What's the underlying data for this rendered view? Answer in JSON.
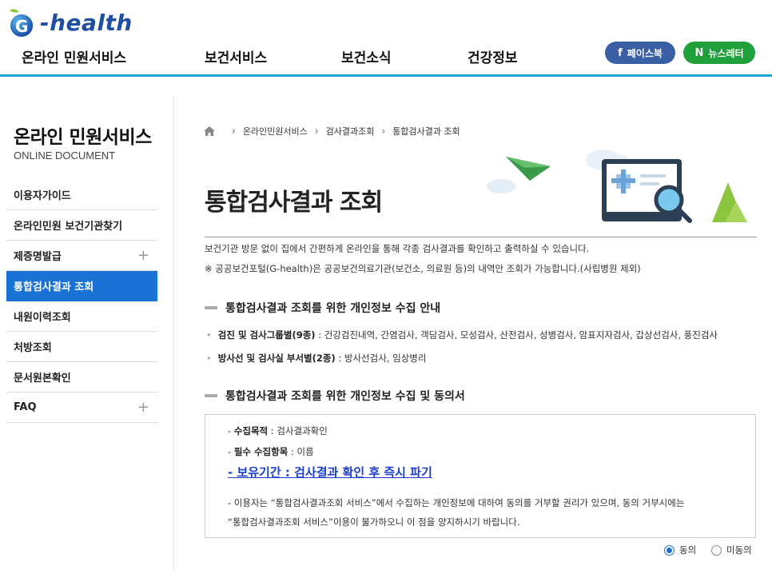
{
  "brand": {
    "logo_text": "-health"
  },
  "gnb": [
    "온라인 민원서비스",
    "보건서비스",
    "보건소식",
    "건강정보"
  ],
  "sns": {
    "facebook_label": "페이스북",
    "facebook_icon": "f",
    "newsletter_label": "뉴스레터",
    "newsletter_icon": "N"
  },
  "sidebar": {
    "title": "온라인 민원서비스",
    "subtitle": "ONLINE DOCUMENT",
    "items": [
      {
        "label": "이용자가이드"
      },
      {
        "label": "온라인민원 보건기관찾기"
      },
      {
        "label": "제증명발급",
        "expand": "+"
      },
      {
        "label": "통합검사결과 조회"
      },
      {
        "label": "내원이력조회"
      },
      {
        "label": "처방조회"
      },
      {
        "label": "문서원본확인"
      },
      {
        "label": "FAQ",
        "expand": "+"
      }
    ]
  },
  "breadcrumb": [
    "온라인민원서비스",
    "검사결과조회",
    "통합검사결과 조회"
  ],
  "main": {
    "title": "통합검사결과 조회",
    "desc1": "보건기관 방문 없이 집에서 간편하게 온라인을 통해 각종 검사결과를 확인하고 출력하실 수 있습니다.",
    "desc2": "※ 공공보건포털(G-health)은 공공보건의료기관(보건소, 의료원 등)의 내역만 조회가 가능합니다.(사립병원 제외)",
    "section1": {
      "title": "통합검사결과 조회를 위한 개인정보 수집 안내",
      "b1_label": "검진 및 검사그룹별(9종)",
      "b1_text": " : 건강검진내역, 간염검사, 객담검사, 모성검사, 산전검사, 성병검사, 암표지자검사, 갑상선검사, 풍진검사",
      "b2_label": "방사선 및 검사실 부서별(2종)",
      "b2_text": " : 방사선검사, 임상병리"
    },
    "section2": {
      "title": "통합검사결과 조회를 위한 개인정보 수집 및 동의서",
      "purpose_label": "수집목적",
      "purpose_text": " : 검사결과확인",
      "items_label": "필수 수집항목",
      "items_text": " : 이름",
      "retention": "- 보유기간 : 검사결과 확인 후 즉시 파기",
      "notice1": "- 이용자는 “통합검사결과조회 서비스”에서 수집하는 개인정보에 대하여 동의를 거부할 권리가 있으며, 동의 거부시에는",
      "notice2": "“통합검사결과조회 서비스”이용이 불가하오니 이 점을 양지하시기 바랍니다."
    },
    "consent": {
      "agree": "동의",
      "disagree": "미동의",
      "selected": "agree"
    }
  }
}
